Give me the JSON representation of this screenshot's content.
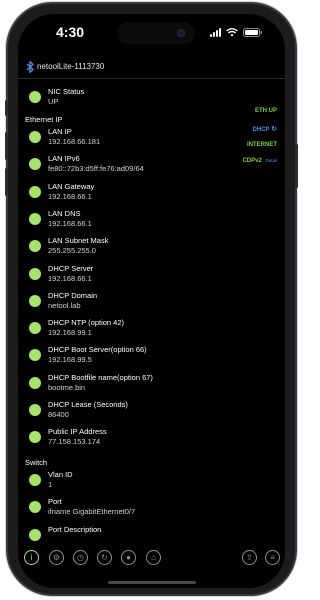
{
  "status_bar": {
    "time": "4:30"
  },
  "header": {
    "device_name": "netoolLite-1113730"
  },
  "nic": {
    "label": "NIC Status",
    "value": "UP"
  },
  "ethernet": {
    "section_title": "Ethernet IP",
    "rows": [
      {
        "label": "LAN IP",
        "value": "192.168.66.181"
      },
      {
        "label": "LAN IPv6",
        "value": "fe80::72b3:d5ff:fe76:ad09/64"
      },
      {
        "label": "LAN Gateway",
        "value": "192.168.66.1"
      },
      {
        "label": "LAN DNS",
        "value": "192.168.66.1"
      },
      {
        "label": "LAN Subnet Mask",
        "value": "255.255.255.0"
      },
      {
        "label": "DHCP Server",
        "value": "192.168.66.1"
      },
      {
        "label": "DHCP Domain",
        "value": "netool.lab"
      },
      {
        "label": "DHCP NTP (option 42)",
        "value": "192.168.99.1"
      },
      {
        "label": "DHCP Boot Server(option 66)",
        "value": "192.168.99.5"
      },
      {
        "label": "DHCP Bootfile name(option 67)",
        "value": "bootme.bin"
      },
      {
        "label": "DHCP Lease (Seconds)",
        "value": "86400"
      },
      {
        "label": "Public IP Address",
        "value": "77.158.153.174"
      }
    ]
  },
  "side_status": {
    "eth_up": "ETH UP",
    "dhcp": "DHCP",
    "internet": "INTERNET",
    "cdp": "CDPv2",
    "cdp_detail": "Detail"
  },
  "switch": {
    "section_title": "Switch",
    "rows": [
      {
        "label": "Vlan ID",
        "value": "1"
      },
      {
        "label": "Port",
        "value": "ifname GigabitEthernet0/7"
      },
      {
        "label": "Port Description",
        "value": ""
      }
    ]
  },
  "tabs": [
    {
      "icon": "info-icon",
      "glyph": "i",
      "active": true
    },
    {
      "icon": "settings-icon",
      "glyph": "⚙"
    },
    {
      "icon": "history-icon",
      "glyph": "◷"
    },
    {
      "icon": "refresh-icon",
      "glyph": "↻"
    },
    {
      "icon": "record-icon",
      "glyph": "●"
    },
    {
      "icon": "tag-icon",
      "glyph": "⌂"
    },
    {
      "icon": "share-icon",
      "glyph": "⇪"
    },
    {
      "icon": "list-icon",
      "glyph": "≡"
    }
  ],
  "colors": {
    "accent": "#a6e36a",
    "status_green": "#7ad03a",
    "status_blue": "#4a90e2"
  }
}
